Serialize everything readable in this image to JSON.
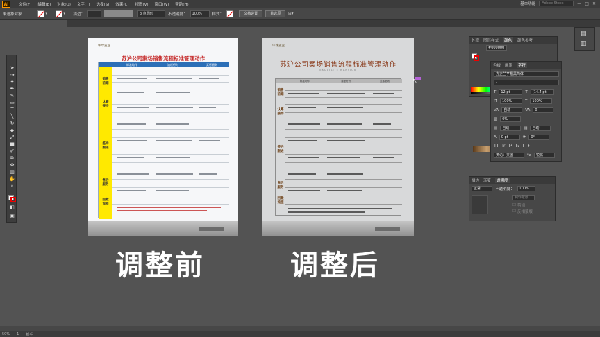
{
  "app": {
    "logo": "Ai",
    "menus": [
      "文件(F)",
      "编辑(E)",
      "对象(O)",
      "文字(T)",
      "选择(S)",
      "效果(C)",
      "视图(V)",
      "窗口(W)",
      "帮助(H)"
    ],
    "workspace": "基本功能",
    "search_placeholder": "Adobe Stock",
    "window_buttons": [
      "—",
      "□",
      "✕"
    ]
  },
  "control_bar": {
    "selection_state": "未选择对象",
    "stroke_label": "描边：",
    "brush_value": "3 点圆形",
    "opacity_label": "不透明度：",
    "opacity_value": "100%",
    "style_label": "样式：",
    "doc_setup": "文档设置",
    "preferences": "首选项"
  },
  "artboards": [
    {
      "title": "苏沪公司案场销售流程标准管理动作",
      "brand": "环球置业",
      "columns": [
        "标准动作",
        "流程行为",
        "奖惩细则"
      ],
      "sections": [
        "销售前期",
        "认筹接待",
        "签约跟进",
        "售后服务",
        "回款流程"
      ]
    },
    {
      "title": "苏沪公司案场销售流程标准管理动作",
      "subtitle": "EXQUISITE MANSION",
      "brand": "环球置业",
      "columns": [
        "标准动作",
        "流程行为",
        "奖惩细则"
      ],
      "sections": [
        "销售前期",
        "认筹接待",
        "签约跟进",
        "售后服务",
        "回款流程"
      ]
    }
  ],
  "captions": {
    "before": "调整前",
    "after": "调整后"
  },
  "panels": {
    "top_tabs": [
      "外观",
      "图形样式",
      "颜色",
      "颜色参考"
    ],
    "color_hex": "#000000",
    "char_tabs": [
      "色板",
      "画笔",
      "字符"
    ],
    "font_family": "方正兰亭粗黑简体",
    "font_style": "-",
    "font_size": "12 pt",
    "leading": "(14.4 pt)",
    "h_scale": "100%",
    "v_scale": "100%",
    "kerning": "自动",
    "tracking": "0",
    "rotate": "0%",
    "baseline": "0 pt",
    "char_rotate": "0°",
    "auto_label": "自动",
    "lang": "英语：美国",
    "aa": "锐化",
    "transparency_tabs": [
      "描边",
      "渐变",
      "透明度"
    ],
    "blend_mode": "正常",
    "opacity_label": "不透明度：",
    "opacity_value": "100%",
    "make_mask": "制作蒙版",
    "clip": "剪切",
    "invert_mask": "反相蒙版"
  },
  "status": {
    "zoom": "50%",
    "page": "1",
    "tool": "抓手"
  },
  "colors": {
    "accent_yellow": "#ffe900",
    "header_blue": "#2c6fb7",
    "title_red": "#c52b2b",
    "caption_white": "#ffffff"
  }
}
